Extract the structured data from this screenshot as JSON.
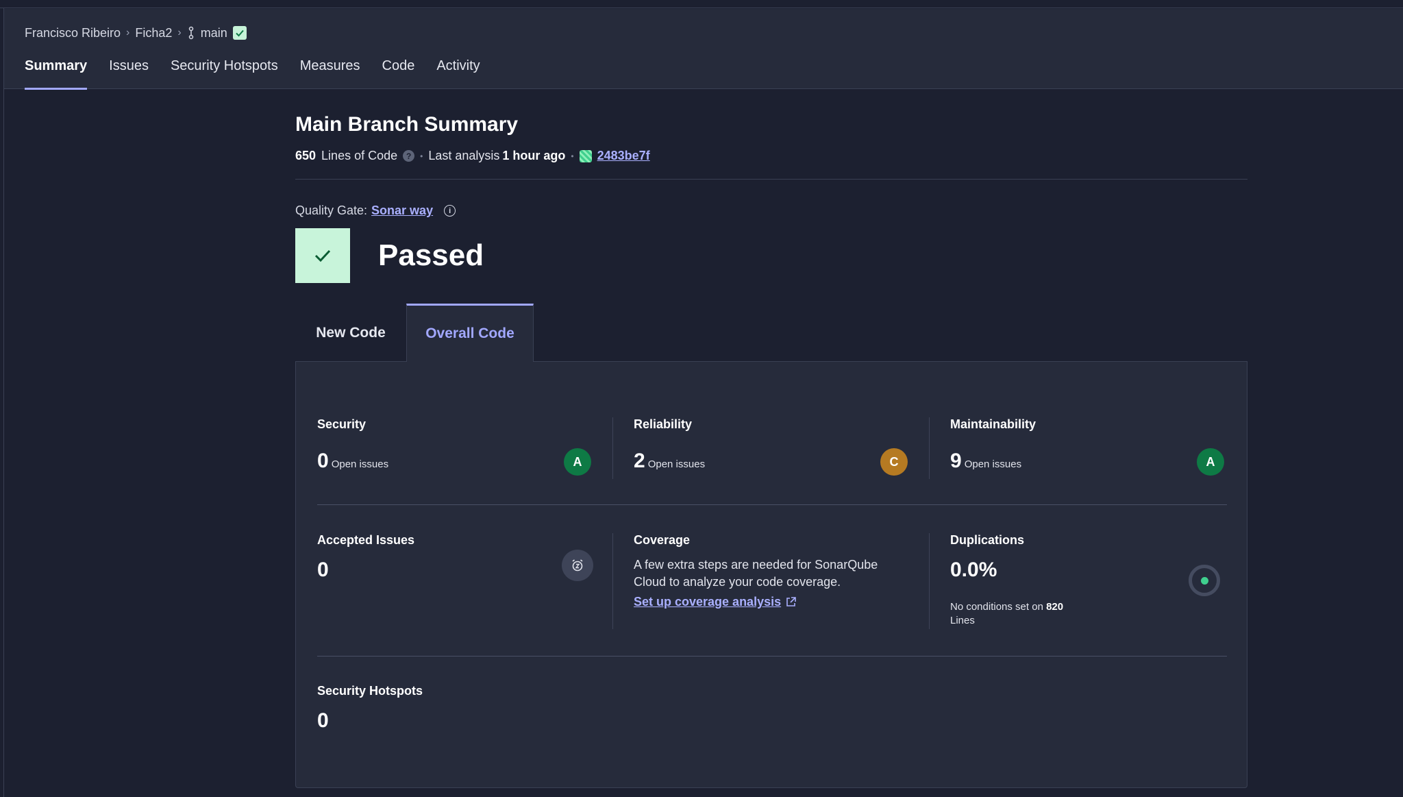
{
  "breadcrumb": {
    "org": "Francisco Ribeiro",
    "project": "Ficha2",
    "branch": "main"
  },
  "tabs": [
    "Summary",
    "Issues",
    "Security Hotspots",
    "Measures",
    "Code",
    "Activity"
  ],
  "active_tab": "Summary",
  "summary": {
    "title": "Main Branch Summary",
    "lines_of_code": "650",
    "lines_of_code_label": "Lines of Code",
    "last_analysis_label": "Last analysis",
    "last_analysis_value": "1 hour ago",
    "commit": "2483be7f"
  },
  "quality_gate": {
    "label": "Quality Gate:",
    "name": "Sonar way",
    "status": "Passed",
    "status_color": "#c8f4da"
  },
  "code_tabs": {
    "new": "New Code",
    "overall": "Overall Code",
    "active": "Overall Code"
  },
  "metrics": {
    "security": {
      "label": "Security",
      "value": "0",
      "unit": "Open issues",
      "grade": "A",
      "grade_color": "#0e7a45"
    },
    "reliability": {
      "label": "Reliability",
      "value": "2",
      "unit": "Open issues",
      "grade": "C",
      "grade_color": "#b57a22"
    },
    "maintainability": {
      "label": "Maintainability",
      "value": "9",
      "unit": "Open issues",
      "grade": "A",
      "grade_color": "#0e7a45"
    },
    "accepted": {
      "label": "Accepted Issues",
      "value": "0"
    },
    "coverage": {
      "label": "Coverage",
      "text": "A few extra steps are needed for SonarQube Cloud to analyze your code coverage.",
      "link": "Set up coverage analysis"
    },
    "duplications": {
      "label": "Duplications",
      "value": "0.0%",
      "note_prefix": "No conditions set on",
      "lines": "820",
      "lines_suffix": "Lines"
    },
    "hotspots": {
      "label": "Security Hotspots",
      "value": "0"
    }
  },
  "colors": {
    "accent": "#a2a8ff",
    "background": "#1c2030",
    "panel": "#262b3b"
  }
}
